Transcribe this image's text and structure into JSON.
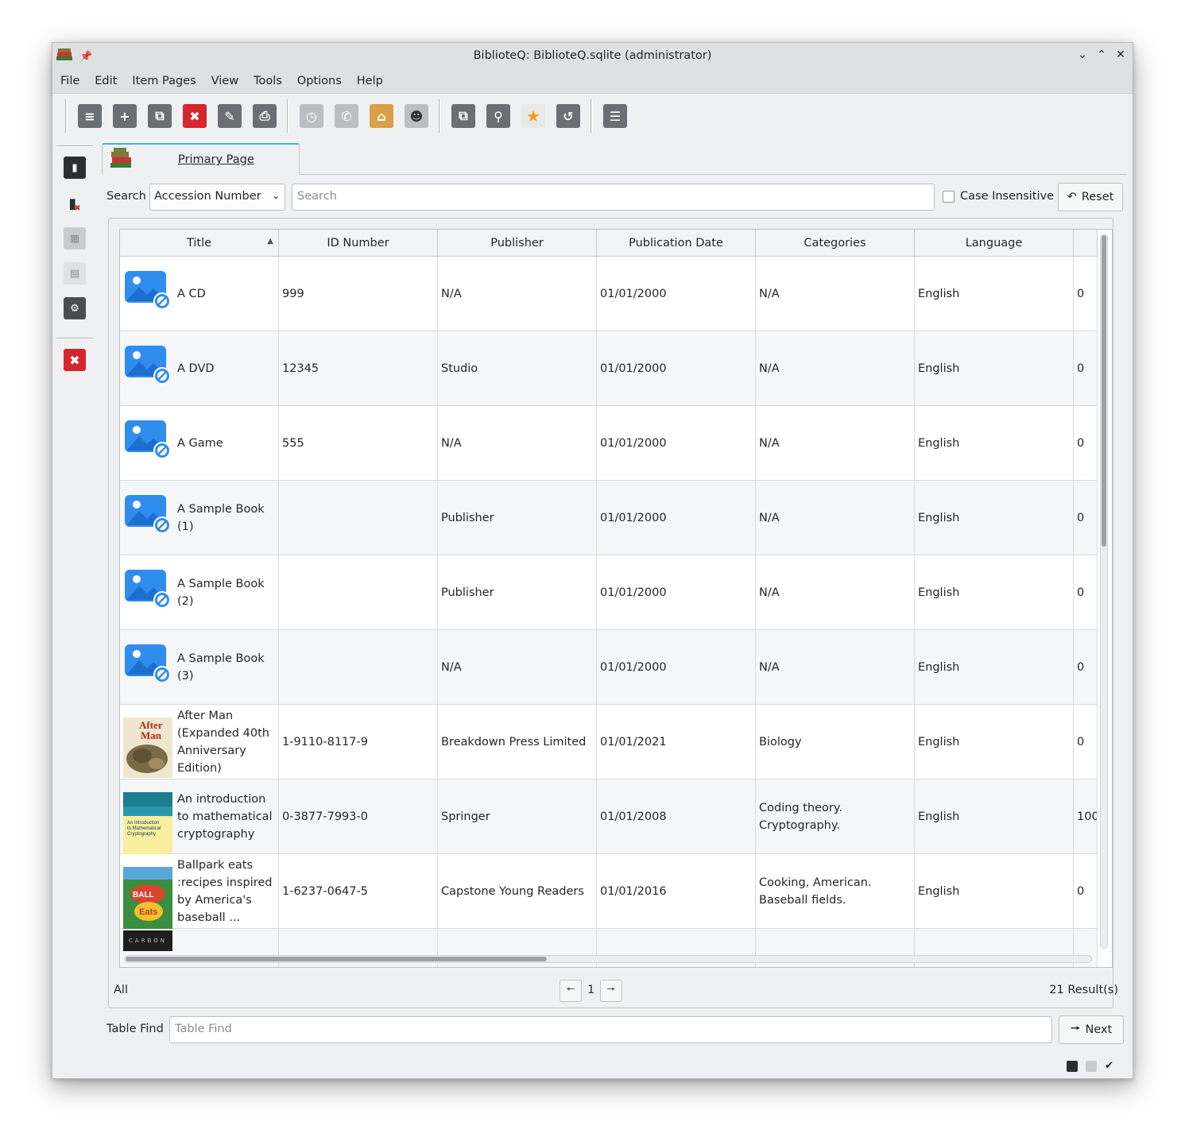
{
  "window": {
    "title": "BiblioteQ: BiblioteQ.sqlite (administrator)"
  },
  "menu": [
    "File",
    "Edit",
    "Item Pages",
    "View",
    "Tools",
    "Options",
    "Help"
  ],
  "tab": {
    "label": "Primary Page"
  },
  "search": {
    "label": "Search",
    "field": "Accession Number",
    "placeholder": "Search",
    "case_insensitive_label": "Case Insensitive",
    "reset_label": "Reset"
  },
  "table": {
    "columns": [
      "Title",
      "ID Number",
      "Publisher",
      "Publication Date",
      "Categories",
      "Language",
      ""
    ],
    "rows": [
      {
        "title": "A CD",
        "id": "999",
        "publisher": "N/A",
        "date": "01/01/2000",
        "categories": "N/A",
        "language": "English",
        "extra": "0",
        "thumb": "placeholder-icon"
      },
      {
        "title": "A DVD",
        "id": "12345",
        "publisher": "Studio",
        "date": "01/01/2000",
        "categories": "N/A",
        "language": "English",
        "extra": "0",
        "thumb": "placeholder-icon"
      },
      {
        "title": "A Game",
        "id": "555",
        "publisher": "N/A",
        "date": "01/01/2000",
        "categories": "N/A",
        "language": "English",
        "extra": "0",
        "thumb": "placeholder-icon"
      },
      {
        "title": "A Sample Book (1)",
        "id": "",
        "publisher": "Publisher",
        "date": "01/01/2000",
        "categories": "N/A",
        "language": "English",
        "extra": "0",
        "thumb": "placeholder-icon"
      },
      {
        "title": "A Sample Book (2)",
        "id": "",
        "publisher": "Publisher",
        "date": "01/01/2000",
        "categories": "N/A",
        "language": "English",
        "extra": "0",
        "thumb": "placeholder-icon"
      },
      {
        "title": "A Sample Book (3)",
        "id": "",
        "publisher": "N/A",
        "date": "01/01/2000",
        "categories": "N/A",
        "language": "English",
        "extra": "0",
        "thumb": "placeholder-icon"
      },
      {
        "title": "After Man (Expanded 40th Anniversary Edition)",
        "id": "1-9110-8117-9",
        "publisher": "Breakdown Press Limited",
        "date": "01/01/2021",
        "categories": "Biology",
        "language": "English",
        "extra": "0",
        "thumb": "cover-after-man"
      },
      {
        "title": "An introduction to mathematical cryptography",
        "id": "0-3877-7993-0",
        "publisher": "Springer",
        "date": "01/01/2008",
        "categories": "Coding theory. Cryptography.",
        "language": "English",
        "extra": "100",
        "thumb": "cover-cryptography"
      },
      {
        "title": "Ballpark eats :recipes inspired by America's baseball ...",
        "id": "1-6237-0647-5",
        "publisher": "Capstone Young Readers",
        "date": "01/01/2016",
        "categories": "Cooking, American. Baseball fields.",
        "language": "English",
        "extra": "0",
        "thumb": "cover-ballpark"
      }
    ],
    "partial_row_thumb_text": "CARBON"
  },
  "pager": {
    "filter": "All",
    "page": "1",
    "results": "21 Result(s)"
  },
  "find": {
    "label": "Table Find",
    "placeholder": "Table Find",
    "next_label": "Next"
  }
}
